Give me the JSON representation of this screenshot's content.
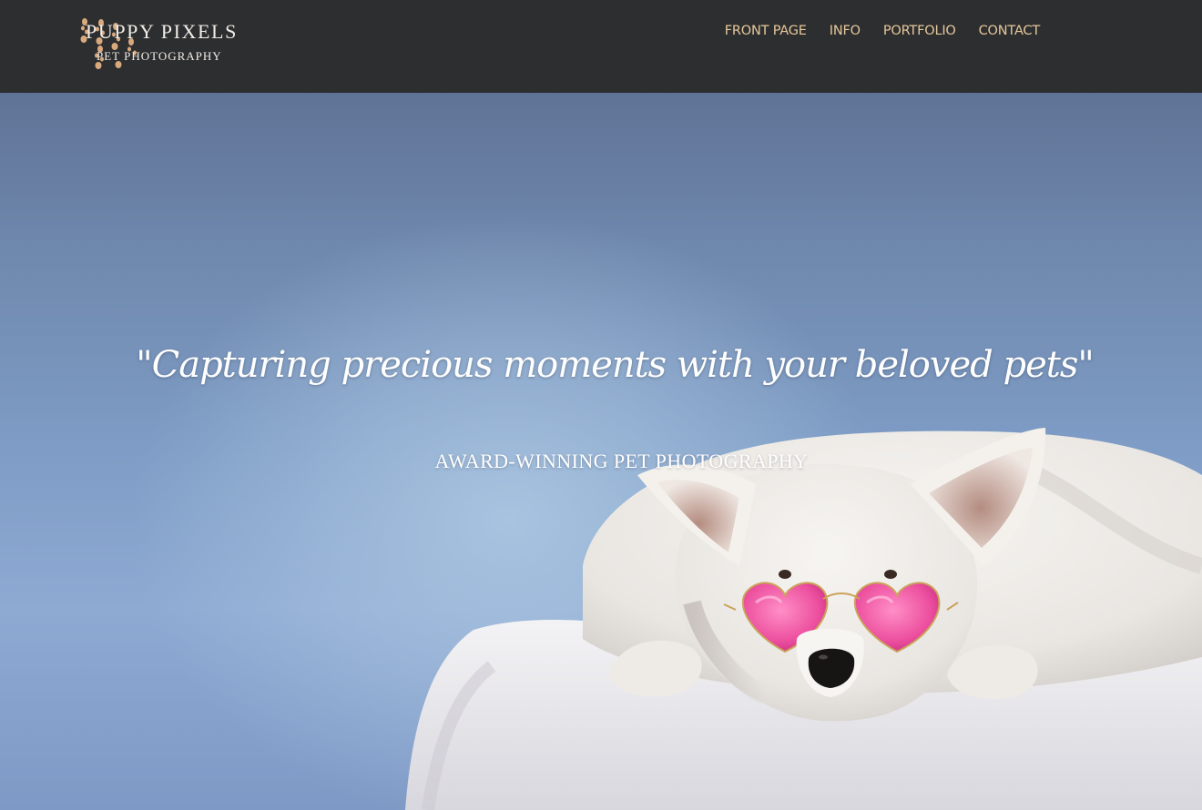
{
  "brand": {
    "title": "PUPPY PIXELS",
    "subtitle": "PET PHOTOGRAPHY",
    "icon": "paw-prints-icon",
    "accent_color": "#d9a97e"
  },
  "nav": {
    "items": [
      {
        "label": "FRONT PAGE"
      },
      {
        "label": "INFO"
      },
      {
        "label": "PORTFOLIO"
      },
      {
        "label": "CONTACT"
      }
    ],
    "text_color": "#e5c79a",
    "bar_color": "#2d2e30"
  },
  "hero": {
    "quote": "\"Capturing precious moments with your beloved pets\"",
    "tagline": "AWARD-WINNING PET PHOTOGRAPHY",
    "image": "white-dog-with-pink-heart-sunglasses-photo"
  }
}
